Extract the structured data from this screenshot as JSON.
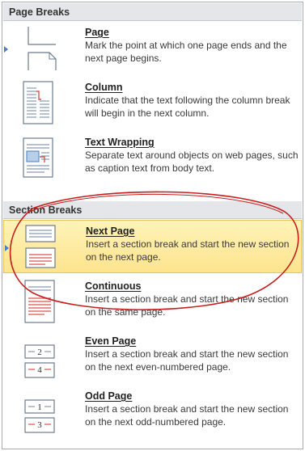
{
  "page_breaks": {
    "header": "Page Breaks",
    "items": [
      {
        "title": "Page",
        "description": "Mark the point at which one page ends and the next page begins."
      },
      {
        "title": "Column",
        "description": "Indicate that the text following the column break will begin in the next column."
      },
      {
        "title": "Text Wrapping",
        "description": "Separate text around objects on web pages, such as caption text from body text."
      }
    ]
  },
  "section_breaks": {
    "header": "Section Breaks",
    "items": [
      {
        "title": "Next Page",
        "description": "Insert a section break and start the new section on the next page.",
        "selected": true
      },
      {
        "title": "Continuous",
        "description": "Insert a section break and start the new section on the same page."
      },
      {
        "title": "Even Page",
        "description": "Insert a section break and start the new section on the next even-numbered page.",
        "icon_numbers": [
          "2",
          "4"
        ]
      },
      {
        "title": "Odd Page",
        "description": "Insert a section break and start the new section on the next odd-numbered page.",
        "icon_numbers": [
          "1",
          "3"
        ]
      }
    ]
  },
  "colors": {
    "highlight_fill": "#fde48e",
    "highlight_border": "#e9c35a",
    "annotation_ellipse": "#c81e1e",
    "section_marker": "#d9534f",
    "icon_blue": "#4a7ec7"
  }
}
